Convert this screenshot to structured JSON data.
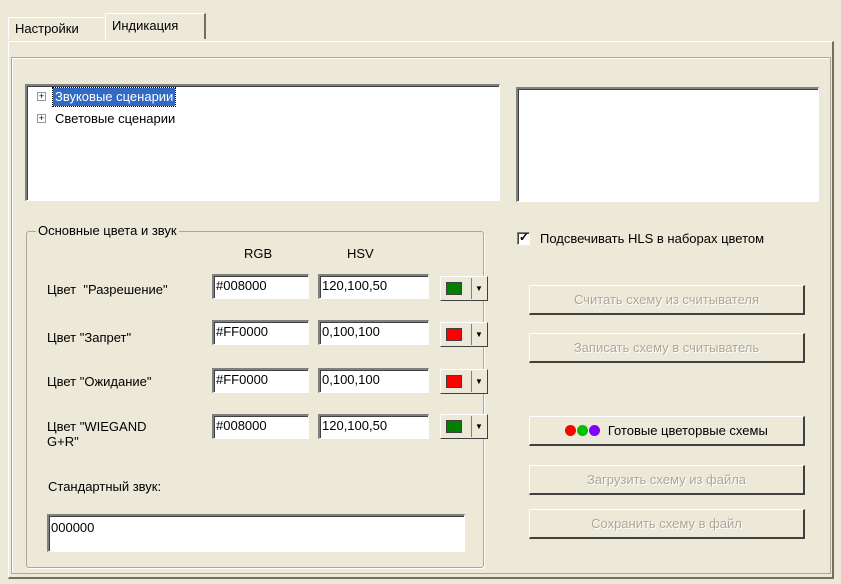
{
  "tabs": [
    {
      "label": "Настройки",
      "active": false
    },
    {
      "label": "Индикация",
      "active": true
    }
  ],
  "tree": {
    "items": [
      {
        "label": "Звуковые сценарии",
        "expander": "+",
        "selected": true
      },
      {
        "label": "Световые сценарии",
        "expander": "+",
        "selected": false
      }
    ]
  },
  "group": {
    "title": "Основные цвета и звук",
    "col_rgb": "RGB",
    "col_hsv": "HSV",
    "rows": [
      {
        "label": "Цвет  \"Разрешение\"",
        "rgb": "#008000",
        "hsv": "120,100,50",
        "swatch": "#008000"
      },
      {
        "label": "Цвет \"Запрет\"",
        "rgb": "#FF0000",
        "hsv": "0,100,100",
        "swatch": "#FF0000"
      },
      {
        "label": "Цвет \"Ожидание\"",
        "rgb": "#FF0000",
        "hsv": "0,100,100",
        "swatch": "#FF0000"
      },
      {
        "label_line1": "Цвет \"WIEGAND",
        "label_line2": "G+R\"",
        "rgb": "#008000",
        "hsv": "120,100,50",
        "swatch": "#008000"
      }
    ],
    "sound_label": "Стандартный звук:",
    "sound_value": "000000"
  },
  "highlight_checkbox": {
    "label": "Подсвечивать HLS в наборах цветом",
    "checked": true
  },
  "buttons": {
    "read_scheme": "Считать схему из считывателя",
    "write_scheme": "Записать схему в считыватель",
    "ready_schemes": "Готовые цветорвые схемы",
    "load_scheme": "Загрузить схему из файла",
    "save_scheme": "Сохранить схему в файл"
  },
  "colors": {
    "dot_red": "#ff0000",
    "dot_green": "#00c000",
    "dot_purple": "#8000ff",
    "selection": "#316ac5"
  }
}
